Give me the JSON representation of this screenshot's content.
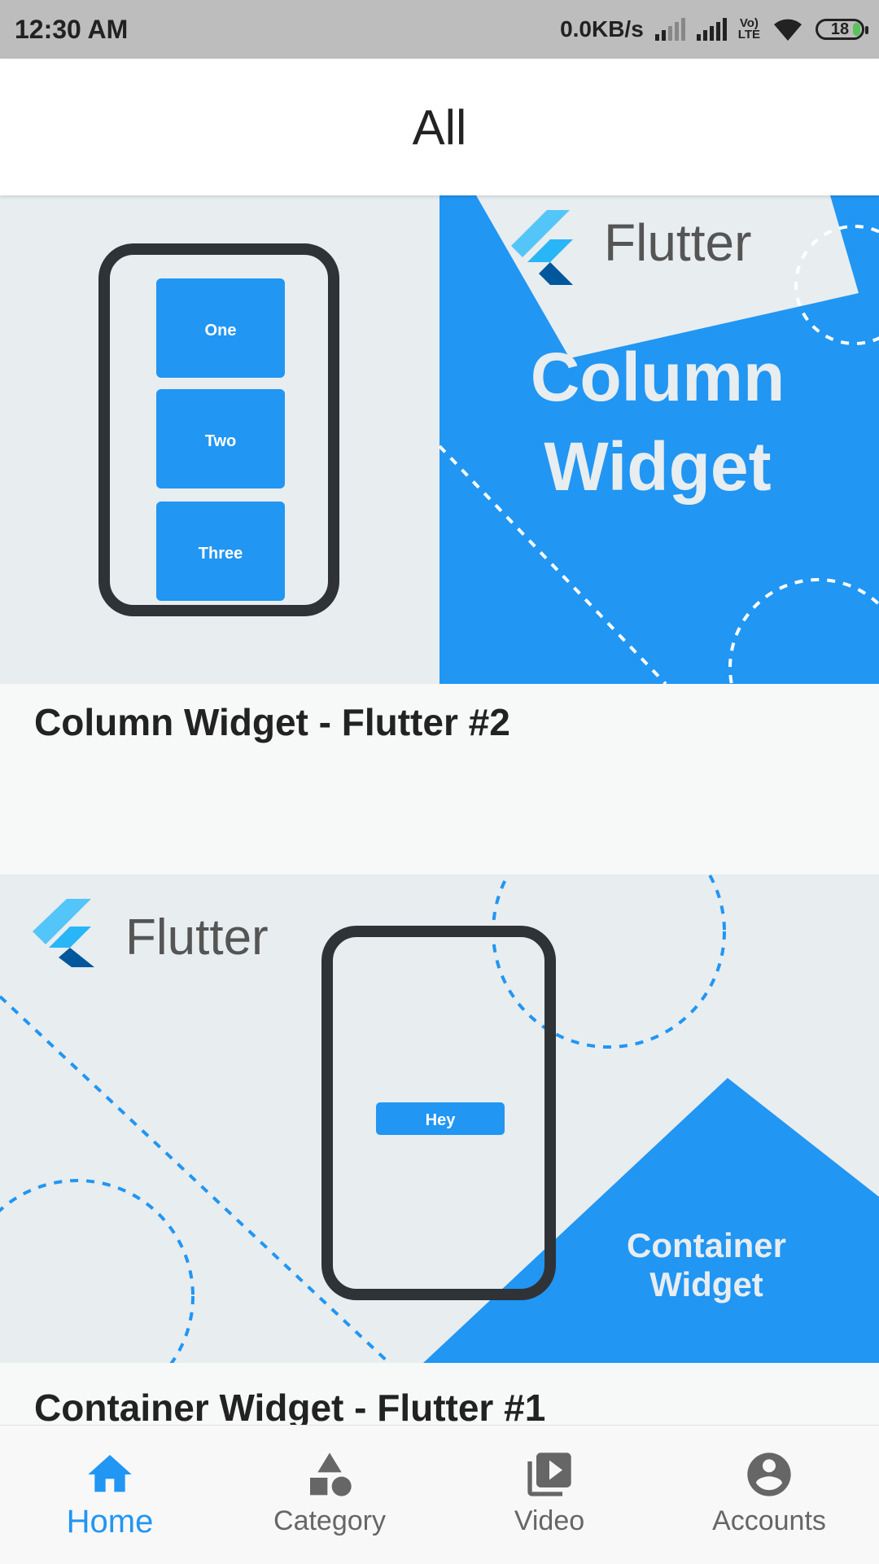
{
  "status_bar": {
    "time": "12:30 AM",
    "net_speed": "0.0KB/s",
    "volte_line1": "Vo)",
    "volte_line2": "LTE",
    "battery_level": "18"
  },
  "app_bar": {
    "title": "All"
  },
  "posts": [
    {
      "title": "Column Widget - Flutter #2",
      "thumb": {
        "boxes": [
          "One",
          "Two",
          "Three"
        ],
        "brand": "Flutter",
        "headline_1": "Column",
        "headline_2": "Widget"
      }
    },
    {
      "title": "Container Widget - Flutter #1",
      "thumb": {
        "brand": "Flutter",
        "button": "Hey",
        "headline_1": "Container",
        "headline_2": "Widget"
      }
    }
  ],
  "bottom_nav": {
    "items": [
      {
        "label": "Home",
        "icon": "home-icon",
        "active": true
      },
      {
        "label": "Category",
        "icon": "category-icon",
        "active": false
      },
      {
        "label": "Video",
        "icon": "video-library-icon",
        "active": false
      },
      {
        "label": "Accounts",
        "icon": "account-circle-icon",
        "active": false
      }
    ]
  },
  "colors": {
    "accent": "#2196f3",
    "thumb_bg": "#e8edf0",
    "frame": "#2f3338"
  }
}
